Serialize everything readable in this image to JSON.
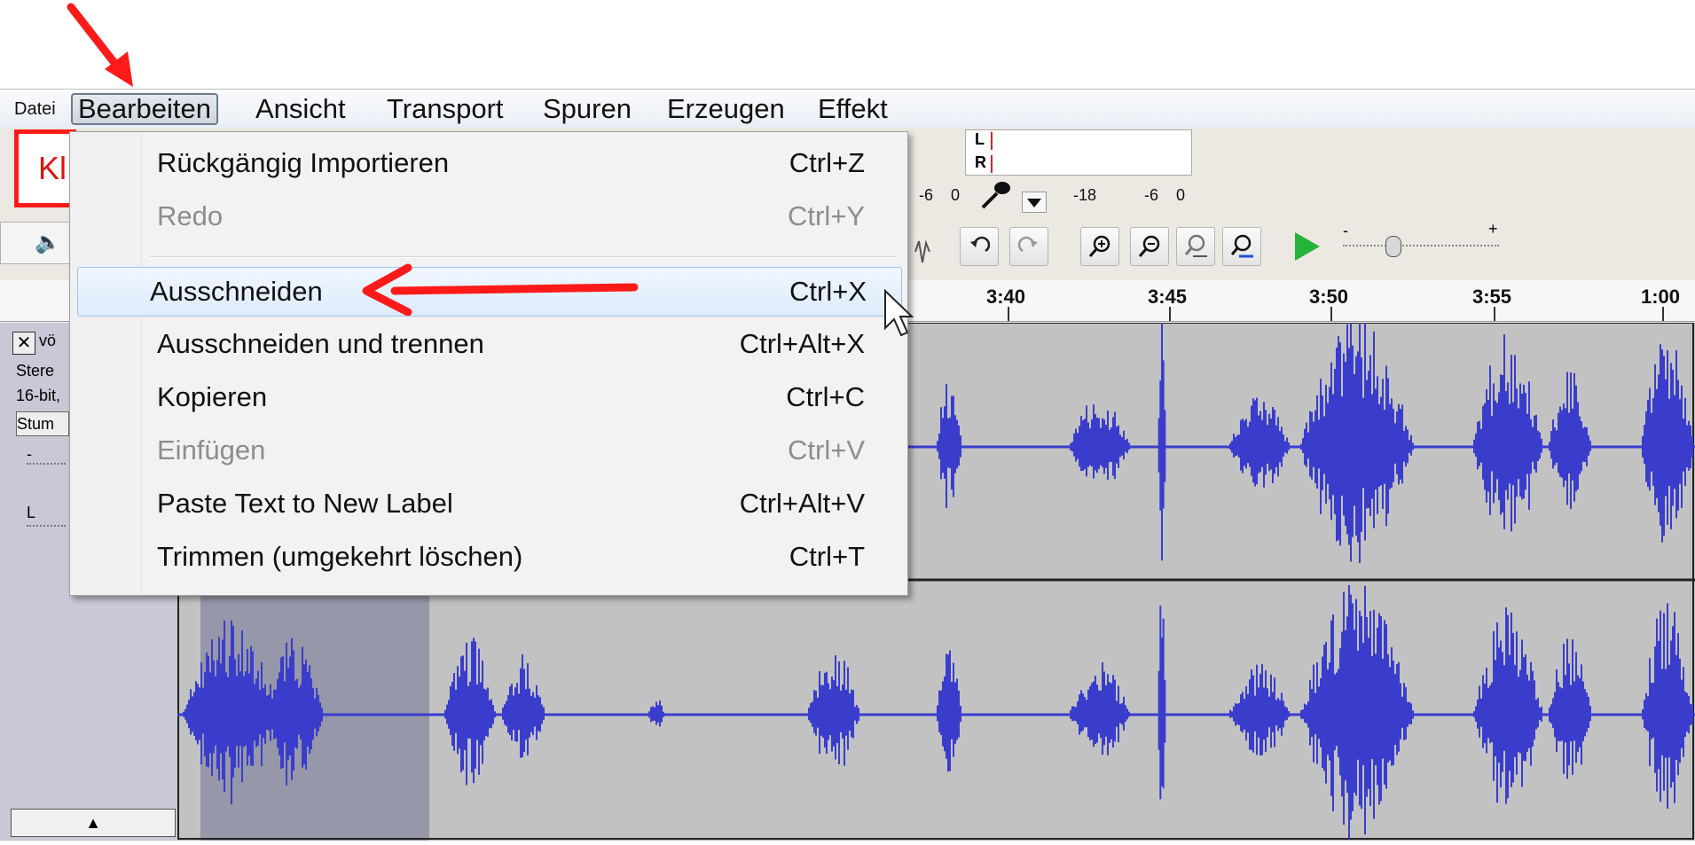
{
  "menubar": {
    "items": [
      "Datei",
      "Bearbeiten",
      "Ansicht",
      "Transport",
      "Spuren",
      "Erzeugen",
      "Effekt"
    ]
  },
  "annotation": {
    "box_text": "Kl"
  },
  "meter": {
    "left_channel": "L",
    "right_channel": "R",
    "ticks": [
      "-6",
      "0",
      "-18",
      "-6",
      "0"
    ],
    "slider_minus": "-",
    "slider_plus": "+"
  },
  "timeline": {
    "labels": [
      "3:40",
      "3:45",
      "3:50",
      "3:55",
      "1:00"
    ]
  },
  "track": {
    "close": "✕",
    "name": "vö",
    "info_line1": "Stere",
    "info_line2": "16-bit,",
    "mute_label": "Stum",
    "collapse": "▲",
    "gain_minus": "-",
    "pan_left": "L"
  },
  "edit_menu": {
    "items": [
      {
        "label": "Rückgängig Importieren",
        "shortcut": "Ctrl+Z",
        "enabled": true
      },
      {
        "label": "Redo",
        "shortcut": "Ctrl+Y",
        "enabled": false
      },
      {
        "label": "Ausschneiden",
        "shortcut": "Ctrl+X",
        "enabled": true,
        "highlighted": true
      },
      {
        "label": "Ausschneiden und trennen",
        "shortcut": "Ctrl+Alt+X",
        "enabled": true
      },
      {
        "label": "Kopieren",
        "shortcut": "Ctrl+C",
        "enabled": true
      },
      {
        "label": "Einfügen",
        "shortcut": "Ctrl+V",
        "enabled": false
      },
      {
        "label": "Paste Text to New Label",
        "shortcut": "Ctrl+Alt+V",
        "enabled": true
      },
      {
        "label": "Trimmen (umgekehrt löschen)",
        "shortcut": "Ctrl+T",
        "enabled": true
      }
    ]
  },
  "colors": {
    "waveform": "#3a3dcc",
    "selection": "#9697a8",
    "track_bg": "#c2c2c2",
    "arrow": "#ff1a1a"
  }
}
